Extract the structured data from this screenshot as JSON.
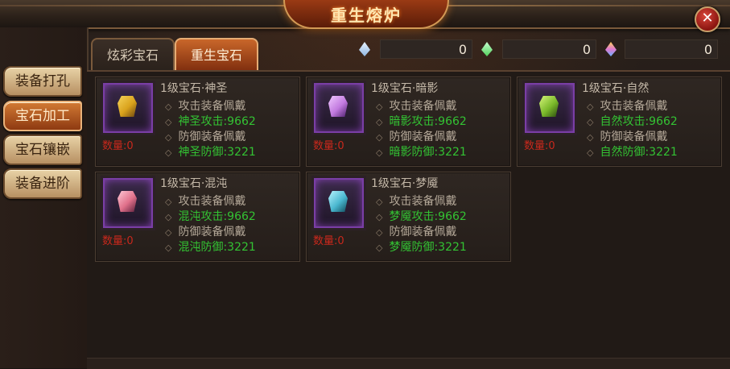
{
  "window": {
    "title": "重生熔炉",
    "close_label": "✕"
  },
  "sidebar": {
    "items": [
      {
        "label": "装备打孔",
        "active": false
      },
      {
        "label": "宝石加工",
        "active": true
      },
      {
        "label": "宝石镶嵌",
        "active": false
      },
      {
        "label": "装备进阶",
        "active": false
      }
    ]
  },
  "tabs": [
    {
      "label": "炫彩宝石",
      "active": false
    },
    {
      "label": "重生宝石",
      "active": true
    }
  ],
  "resources": [
    {
      "icon": "blue-crystal-icon",
      "color": "#8fb6e0",
      "value": "0"
    },
    {
      "icon": "green-crystal-icon",
      "color": "#4fd05a",
      "value": "0"
    },
    {
      "icon": "rainbow-crystal-icon",
      "color": "#e07ad0",
      "value": "0"
    }
  ],
  "gems": [
    {
      "name": "1级宝石·神圣",
      "qty": "数量:0",
      "wear_atk": "攻击装备佩戴",
      "atk": "神圣攻击:9662",
      "wear_def": "防御装备佩戴",
      "def": "神圣防御:3221",
      "color": "#d9a21c"
    },
    {
      "name": "1级宝石·暗影",
      "qty": "数量:0",
      "wear_atk": "攻击装备佩戴",
      "atk": "暗影攻击:9662",
      "wear_def": "防御装备佩戴",
      "def": "暗影防御:3221",
      "color": "#c27adf"
    },
    {
      "name": "1级宝石·自然",
      "qty": "数量:0",
      "wear_atk": "攻击装备佩戴",
      "atk": "自然攻击:9662",
      "wear_def": "防御装备佩戴",
      "def": "自然防御:3221",
      "color": "#7ab82a"
    },
    {
      "name": "1级宝石·混沌",
      "qty": "数量:0",
      "wear_atk": "攻击装备佩戴",
      "atk": "混沌攻击:9662",
      "wear_def": "防御装备佩戴",
      "def": "混沌防御:3221",
      "color": "#e0708a"
    },
    {
      "name": "1级宝石·梦魇",
      "qty": "数量:0",
      "wear_atk": "攻击装备佩戴",
      "atk": "梦魇攻击:9662",
      "wear_def": "防御装备佩戴",
      "def": "梦魇防御:3221",
      "color": "#4ab8d0"
    }
  ]
}
